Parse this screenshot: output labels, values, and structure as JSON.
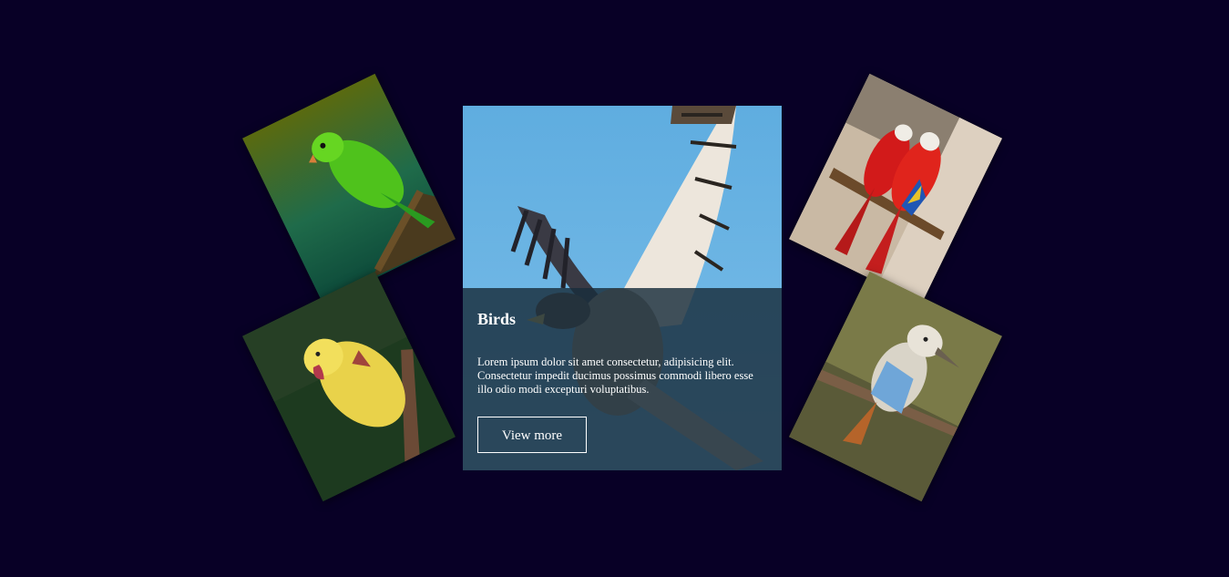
{
  "card": {
    "title": "Birds",
    "description": "Lorem ipsum dolor sit amet consectetur, adipisicing elit. Consectetur impedit ducimus possimus commodi libero esse illo odio modi excepturi voluptatibus.",
    "button_label": "View more",
    "image": "hawk-in-flight-photo"
  },
  "gallery": [
    {
      "image": "green-parakeet-photo"
    },
    {
      "image": "yellow-parrot-photo"
    },
    {
      "image": "scarlet-macaws-photo"
    },
    {
      "image": "kookaburra-photo"
    }
  ],
  "colors": {
    "background": "#080026",
    "overlay": "#192d3c",
    "text": "#ffffff",
    "sky": "#5fade0"
  }
}
